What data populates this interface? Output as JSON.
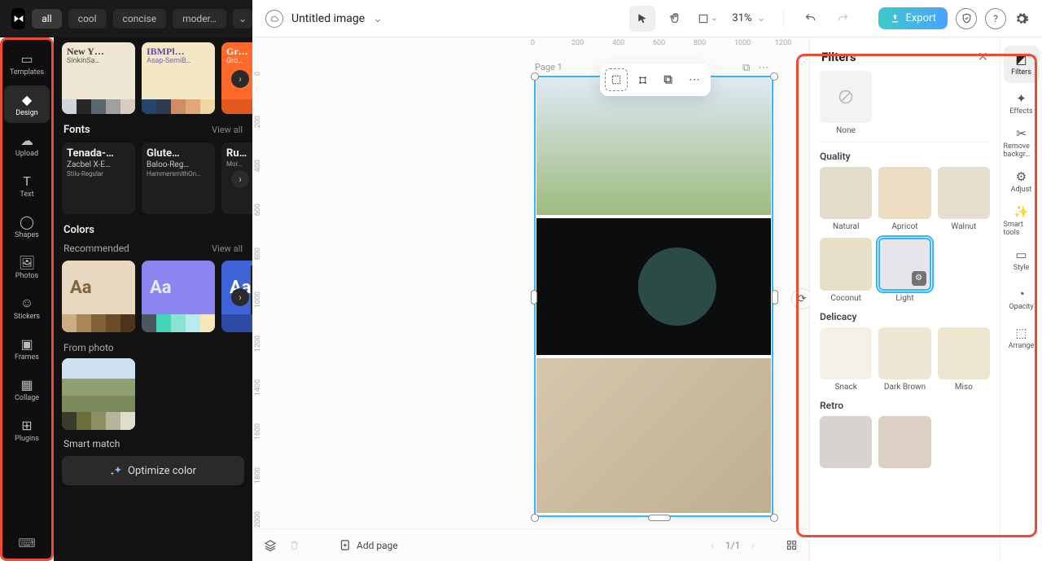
{
  "app": {
    "title": "Untitled image"
  },
  "topbar": {
    "zoom": "31%",
    "export": "Export"
  },
  "chips": [
    "all",
    "cool",
    "concise",
    "moder…"
  ],
  "leftrail": [
    {
      "id": "templates",
      "label": "Templates"
    },
    {
      "id": "design",
      "label": "Design"
    },
    {
      "id": "upload",
      "label": "Upload"
    },
    {
      "id": "text",
      "label": "Text"
    },
    {
      "id": "shapes",
      "label": "Shapes"
    },
    {
      "id": "photos",
      "label": "Photos"
    },
    {
      "id": "stickers",
      "label": "Stickers"
    },
    {
      "id": "frames",
      "label": "Frames"
    },
    {
      "id": "collage",
      "label": "Collage"
    },
    {
      "id": "plugins",
      "label": "Plugins"
    }
  ],
  "sidepanel": {
    "brandcards": [
      {
        "title": "New Y…",
        "sub": "SinkinSa…",
        "bg": "#efe6d3",
        "fg": "#3a3a3a",
        "sw": [
          "#cfd5da",
          "#272727",
          "#5a6773",
          "#a0a0a0",
          "#d9cdbd"
        ]
      },
      {
        "title": "IBMPl…",
        "sub": "Asap-SemiB…",
        "bg": "#f4e7c3",
        "fg": "#5a4da0",
        "sw": [
          "#26456d",
          "#2f3b4e",
          "#d08c63",
          "#e0a875",
          "#f0d6a5"
        ]
      },
      {
        "title": "Gr…",
        "sub": "Gro…",
        "bg": "#ff6a2c",
        "fg": "#fff",
        "sw": [
          "#e05a20"
        ]
      }
    ],
    "fonts_header": "Fonts",
    "view_all": "View all",
    "fontcards": [
      {
        "title": "Tenada-…",
        "sub": "Zacbel X-E…",
        "sub2": "Stilu-Regular"
      },
      {
        "title": "Glute…",
        "sub": "Baloo-Reg…",
        "sub2": "HammersmithOn…"
      },
      {
        "title": "Ru…",
        "sub": "",
        "sub2": "Mor…"
      }
    ],
    "colors_header": "Colors",
    "recommended": "Recommended",
    "colorcards": [
      {
        "bg": "#e7d9bf",
        "fg": "#7e633e",
        "sw": [
          "#caae82",
          "#a88656",
          "#846238",
          "#6a4c28",
          "#4e3519"
        ]
      },
      {
        "bg": "#8a85f0",
        "fg": "#e9e6ff",
        "sw": [
          "#4a5660",
          "#43d6b9",
          "#8ae3d0",
          "#b7ecf2",
          "#f6e8b8"
        ]
      },
      {
        "bg": "#3d63d6",
        "fg": "#fff",
        "sw": [
          "#2d4aa5"
        ]
      }
    ],
    "fromphoto": "From photo",
    "photo_sw": [
      "#3a3c2c",
      "#6c6f3b",
      "#8e8f62",
      "#b5b59a",
      "#dedecb"
    ],
    "smartmatch": "Smart match",
    "optimize": "Optimize color"
  },
  "canvas": {
    "page_label": "Page 1",
    "ruler_h": [
      "0",
      "200",
      "400",
      "600",
      "800",
      "1000",
      "1200"
    ],
    "ruler_v": [
      "0",
      "200",
      "400",
      "600",
      "800",
      "1000",
      "1200",
      "1400",
      "1600",
      "1800",
      "2000"
    ],
    "add_page": "Add page",
    "page_count": "1/1"
  },
  "rightrail": [
    {
      "id": "filters",
      "label": "Filters"
    },
    {
      "id": "effects",
      "label": "Effects"
    },
    {
      "id": "removebg",
      "label": "Remove backgr…"
    },
    {
      "id": "adjust",
      "label": "Adjust"
    },
    {
      "id": "smart",
      "label": "Smart tools"
    },
    {
      "id": "style",
      "label": "Style"
    },
    {
      "id": "opacity",
      "label": "Opacity"
    },
    {
      "id": "arrange",
      "label": "Arrange"
    }
  ],
  "filters": {
    "title": "Filters",
    "none": "None",
    "groups": [
      {
        "name": "Quality",
        "items": [
          {
            "label": "Natural",
            "bg": "#e4dccb"
          },
          {
            "label": "Apricot",
            "bg": "#ecdcc2"
          },
          {
            "label": "Walnut",
            "bg": "#e6dfcf"
          },
          {
            "label": "Coconut",
            "bg": "#e8dfc8"
          },
          {
            "label": "Light",
            "bg": "#e6e6ea",
            "selected": true
          }
        ]
      },
      {
        "name": "Delicacy",
        "items": [
          {
            "label": "Snack",
            "bg": "#f4f2e6"
          },
          {
            "label": "Dark Brown",
            "bg": "#efe7d6"
          },
          {
            "label": "Miso",
            "bg": "#efe6cf"
          }
        ]
      },
      {
        "name": "Retro",
        "items": [
          {
            "label": "",
            "bg": "#d8d3d0"
          },
          {
            "label": "",
            "bg": "#dcd0c4"
          }
        ]
      }
    ]
  }
}
